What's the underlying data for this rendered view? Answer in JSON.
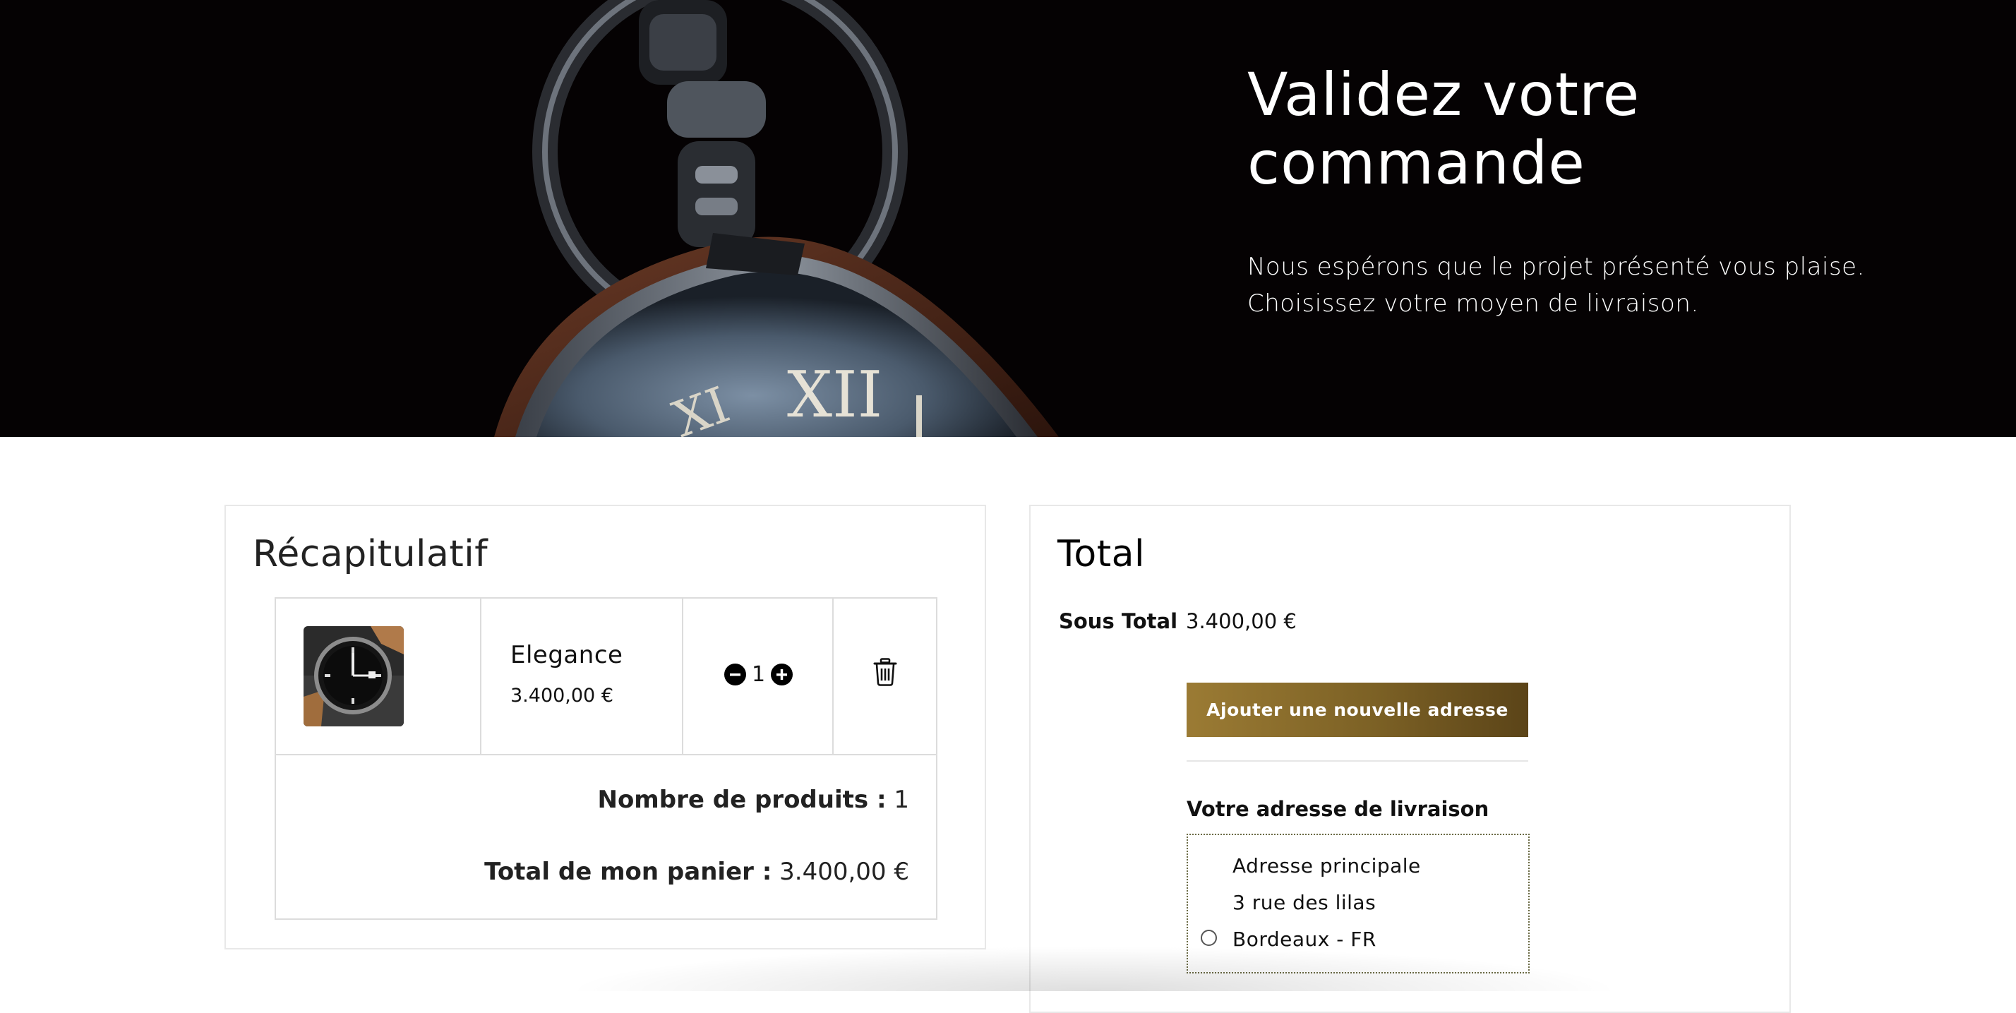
{
  "hero": {
    "title": "Validez votre commande",
    "subtitle": "Nous espérons que le projet présenté vous plaise. Choisissez votre moyen de livraison."
  },
  "recap": {
    "title": "Récapitulatif",
    "item": {
      "name": "Elegance",
      "price": "3.400,00 €",
      "quantity": "1",
      "image": "watch-thumbnail"
    },
    "count_label": "Nombre de produits :",
    "count_value": "1",
    "total_label": "Total de mon panier :",
    "total_value": "3.400,00 €"
  },
  "total": {
    "title": "Total",
    "subtotal_label": "Sous Total",
    "subtotal_value": "3.400,00 €",
    "add_address_button": "Ajouter une nouvelle adresse",
    "shipping_label": "Votre adresse de livraison",
    "address": {
      "name": "Adresse principale",
      "street": "3 rue des lilas",
      "city": "Bordeaux - FR"
    }
  },
  "colors": {
    "accent_gold": "#8a6d2c",
    "hero_bg": "#050203"
  },
  "icons": [
    "minus-circle-icon",
    "plus-circle-icon",
    "trash-icon",
    "radio-unchecked-icon"
  ]
}
